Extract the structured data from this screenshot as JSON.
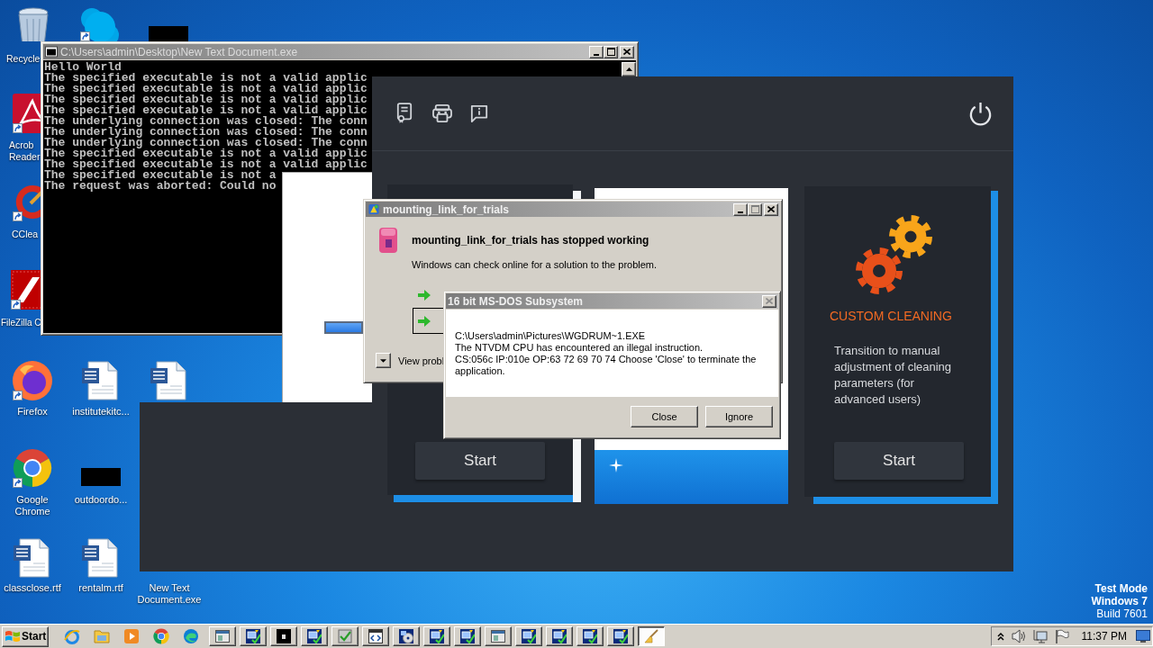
{
  "desktop_icons": [
    {
      "kind": "recycle-bin",
      "label": "Recycle",
      "shortcut": false
    },
    {
      "kind": "chat-app",
      "shortcut": true
    },
    {
      "kind": "thumbnail",
      "shortcut": false
    },
    {
      "kind": "pdf-app",
      "label": "Acrob Reader",
      "shortcut": true
    },
    {
      "kind": "cleaner-app",
      "label": "CClea",
      "shortcut": true
    },
    {
      "kind": "ftp-app",
      "label": "FileZilla C",
      "shortcut": true
    },
    {
      "kind": "fox-browser",
      "label": "Firefox",
      "shortcut": true
    },
    {
      "kind": "word-document",
      "label": "institutekitc...",
      "shortcut": false
    },
    {
      "kind": "word-document",
      "shortcut": false
    },
    {
      "kind": "chrome-browser",
      "label": "Google Chrome",
      "shortcut": true
    },
    {
      "kind": "thumbnail",
      "label": "outdoordo...",
      "shortcut": false
    },
    {
      "kind": "word-document",
      "label": "classclose.rtf",
      "shortcut": false
    },
    {
      "kind": "word-document",
      "label": "rentalm.rtf",
      "shortcut": false
    },
    {
      "label": "New Text Document.exe"
    }
  ],
  "console_window": {
    "title": "C:\\Users\\admin\\Desktop\\New Text Document.exe",
    "lines": [
      "Hello World",
      "The specified executable is not a valid applic",
      "The specified executable is not a valid applic",
      "The specified executable is not a valid applic",
      "The specified executable is not a valid applic",
      "The underlying connection was closed: The conn",
      "The underlying connection was closed: The conn",
      "The underlying connection was closed: The conn",
      "The specified executable is not a valid applic",
      "The specified executable is not a valid applic",
      "The specified executable is not a",
      "The request was aborted: Could no"
    ]
  },
  "blank_window": {
    "progress": {
      "level": 1
    }
  },
  "cleaner_window": {
    "cards": [
      {
        "kind": "panel",
        "button": "Start"
      },
      {
        "kind": "blank"
      },
      {
        "kind": "panel",
        "title": "CUSTOM CLEANING",
        "description": "Transition to manual adjustment of cleaning parameters (for advanced users)",
        "button": "Start"
      }
    ]
  },
  "error_dialog": {
    "title": "mounting_link_for_trials",
    "heading": "mounting_link_for_trials has stopped working",
    "text": "Windows can check online for a solution to the problem.",
    "details": "View probl"
  },
  "dos_dialog": {
    "title": "16 bit MS-DOS Subsystem",
    "message_lines": [
      "C:\\Users\\admin\\Pictures\\WGDRUM~1.EXE",
      "The NTVDM CPU has encountered an illegal instruction.",
      "CS:056c IP:010e OP:63 72 69 70 74 Choose 'Close' to terminate the",
      "application."
    ],
    "buttons": [
      "Close",
      "Ignore"
    ]
  },
  "desktop_notice": [
    {
      "text": "Test Mode",
      "bold": true
    },
    {
      "text": "Windows 7",
      "bold": true
    },
    {
      "text": "Build 7601",
      "bold": false
    }
  ],
  "taskbar": {
    "start": "Start",
    "tasks": [
      {
        "kind": "window",
        "selected": false
      },
      {
        "kind": "installer",
        "selected": false
      },
      {
        "kind": "console",
        "selected": false
      },
      {
        "kind": "installer",
        "selected": false
      },
      {
        "kind": "checklist",
        "selected": false
      },
      {
        "kind": "code-window",
        "selected": false
      },
      {
        "kind": "disc",
        "selected": false
      },
      {
        "kind": "installer",
        "selected": false
      },
      {
        "kind": "installer",
        "selected": false
      },
      {
        "kind": "window",
        "selected": false
      },
      {
        "kind": "installer",
        "selected": false
      },
      {
        "kind": "installer",
        "selected": false
      },
      {
        "kind": "installer",
        "selected": false
      },
      {
        "kind": "installer",
        "selected": false
      },
      {
        "kind": "broom",
        "selected": true
      }
    ],
    "clock": "11:37 PM"
  }
}
